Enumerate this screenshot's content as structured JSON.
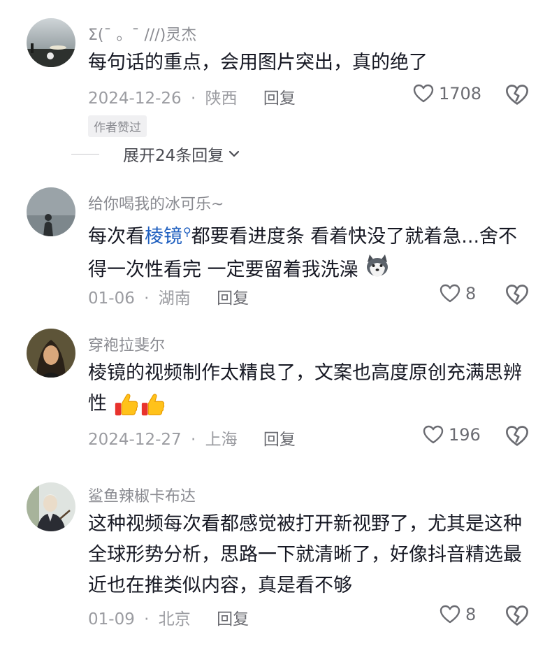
{
  "comments": [
    {
      "username": "Σ(ˉ 。ˉ ///)灵杰",
      "text": "每句话的重点，会用图片突出，真的绝了",
      "date": "2024-12-26",
      "location": "陕西",
      "reply_label": "回复",
      "likes": "1708",
      "badge": "作者赞过",
      "expand_label": "展开24条回复"
    },
    {
      "username": "给你喝我的冰可乐~",
      "text_pre": "每次看",
      "link_text": "棱镜",
      "text_post": "都要看进度条 看着快没了就着急...舍不得一次性看完 一定要留着我洗澡",
      "date": "01-06",
      "location": "湖南",
      "reply_label": "回复",
      "likes": "8"
    },
    {
      "username": "穿袍拉斐尔",
      "text": "棱镜的视频制作太精良了，文案也高度原创充满思辨性",
      "date": "2024-12-27",
      "location": "上海",
      "reply_label": "回复",
      "likes": "196"
    },
    {
      "username": "鲨鱼辣椒卡布达",
      "text": "这种视频每次看都感觉被打开新视野了，尤其是这种全球形势分析，思路一下就清晰了，好像抖音精选最近也在推类似内容，真是看不够",
      "date": "01-09",
      "location": "北京",
      "reply_label": "回复",
      "likes": "8"
    }
  ],
  "icons": {
    "like": "heart-outline-icon",
    "dislike": "broken-heart-icon",
    "expand": "chevron-down-icon",
    "search": "search-icon",
    "emoji_dog": "husky-emoji-icon",
    "emoji_thumb": "thumbs-up-emoji-icon"
  },
  "meta_separator": "·"
}
